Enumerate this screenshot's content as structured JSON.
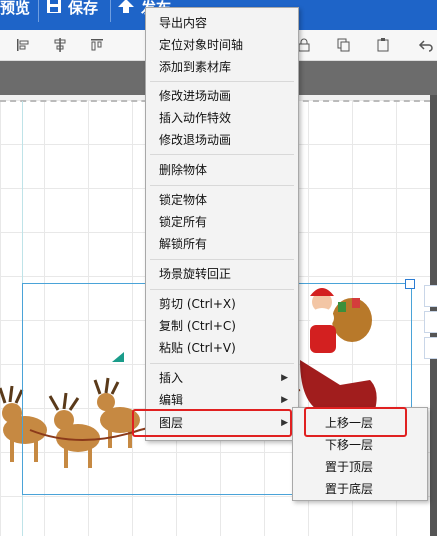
{
  "topbar": {
    "preview_label": "预览",
    "save_label": "保存",
    "publish_label": "发布"
  },
  "context_menu": {
    "items": [
      {
        "label": "导出内容"
      },
      {
        "label": "定位对象时间轴"
      },
      {
        "label": "添加到素材库"
      },
      {
        "label": "修改进场动画"
      },
      {
        "label": "插入动作特效"
      },
      {
        "label": "修改退场动画"
      },
      {
        "label": "删除物体"
      },
      {
        "label": "锁定物体"
      },
      {
        "label": "锁定所有"
      },
      {
        "label": "解锁所有"
      },
      {
        "label": "场景旋转回正"
      },
      {
        "label": "剪切 (Ctrl+X)"
      },
      {
        "label": "复制 (Ctrl+C)"
      },
      {
        "label": "粘贴 (Ctrl+V)"
      },
      {
        "label": "插入"
      },
      {
        "label": "编辑"
      },
      {
        "label": "图层"
      }
    ],
    "highlighted": "图层"
  },
  "layer_submenu": {
    "items": [
      {
        "label": "上移一层"
      },
      {
        "label": "下移一层"
      },
      {
        "label": "置于顶层"
      },
      {
        "label": "置于底层"
      }
    ],
    "highlighted": "上移一层"
  },
  "colors": {
    "topbar": "#1e64c8",
    "highlight": "#e02020",
    "selection": "#4aa3d8"
  },
  "icons": [
    "eye-icon",
    "save-icon",
    "publish-icon",
    "align-left-icon",
    "align-center-icon",
    "align-top-icon",
    "lock-icon",
    "copy-icon",
    "paste-icon",
    "undo-icon",
    "chevron-right-icon"
  ]
}
